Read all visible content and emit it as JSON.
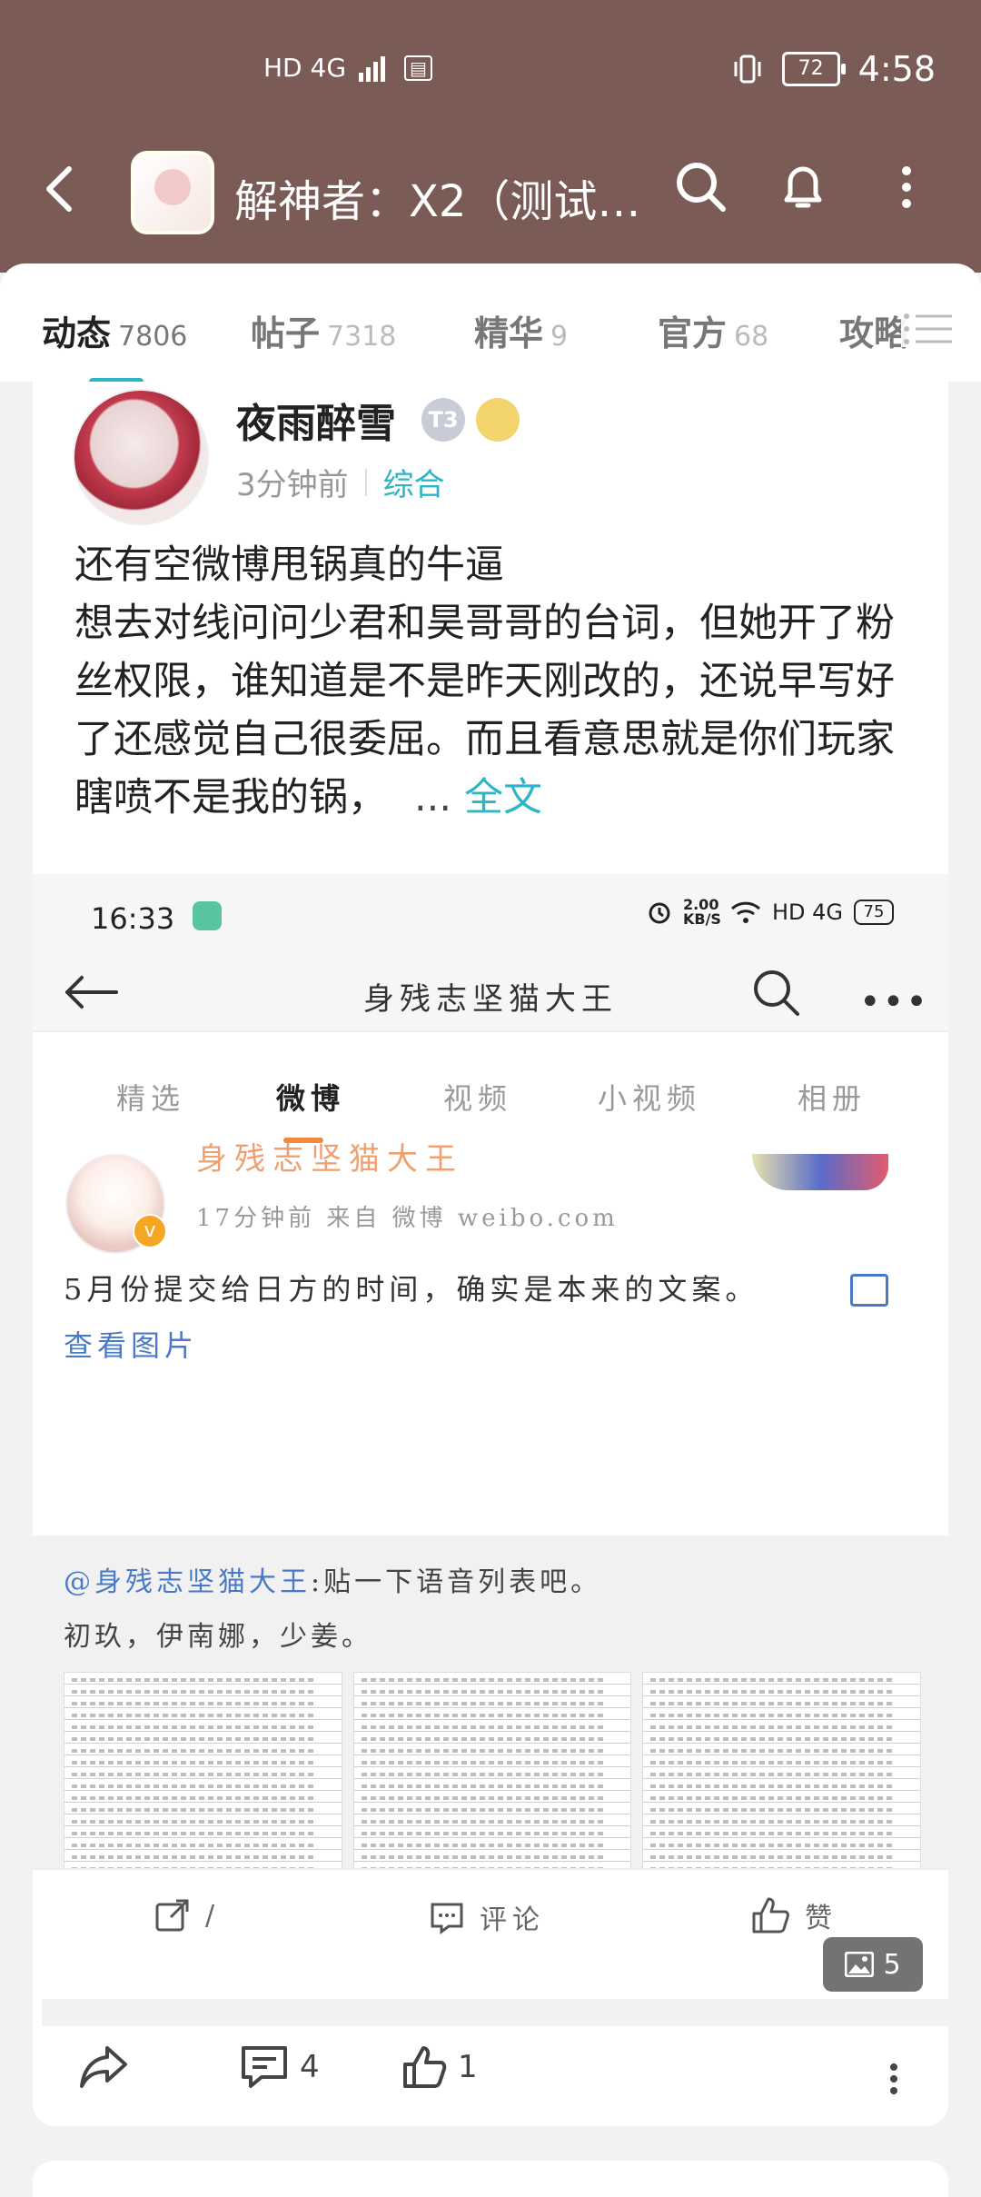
{
  "status_bar": {
    "network": "HD 4G",
    "battery": "72",
    "time": "4:58"
  },
  "header": {
    "title": "解神者：X2（测试…"
  },
  "tabs": [
    {
      "label": "动态",
      "count": "7806"
    },
    {
      "label": "帖子",
      "count": "7318"
    },
    {
      "label": "精华",
      "count": "9"
    },
    {
      "label": "官方",
      "count": "68"
    },
    {
      "label": "攻略",
      "count": ""
    }
  ],
  "post": {
    "author": "夜雨醉雪",
    "level_badge": "T3",
    "time": "3分钟前",
    "category": "综合",
    "text_line1": "还有空微博甩锅真的牛逼",
    "text_body": "想去对线问问少君和昊哥哥的台词，但她开了粉丝权限，谁知道是不是昨天刚改的，还说早写好了还感觉自己很委屈。而且看意思就是你们玩家瞎喷不是我的锅，",
    "ellipsis": "...",
    "more_label": "全文",
    "image_count": "5",
    "footer": {
      "comments": "4",
      "likes": "1"
    }
  },
  "embedded": {
    "status_time": "16:33",
    "status_speed": "2.00 KB/S",
    "status_net": "HD 4G",
    "status_battery": "75",
    "nav_title": "身残志坚猫大王",
    "tabs": [
      "精选",
      "微博",
      "视频",
      "小视频",
      "相册"
    ],
    "author_cut": "身残志坚猫大王",
    "meta": "17分钟前   来自 微博 weibo.com",
    "text": "5月份提交给日方的时间，确实是本来的文案。",
    "view_images": "查看图片",
    "quote_at": "@身残志坚猫大王",
    "quote_text": ":贴一下语音列表吧。",
    "quote_line2": "初玖，伊南娜，少姜。",
    "actions": {
      "share": "/",
      "comment": "评论",
      "like": "赞"
    }
  }
}
